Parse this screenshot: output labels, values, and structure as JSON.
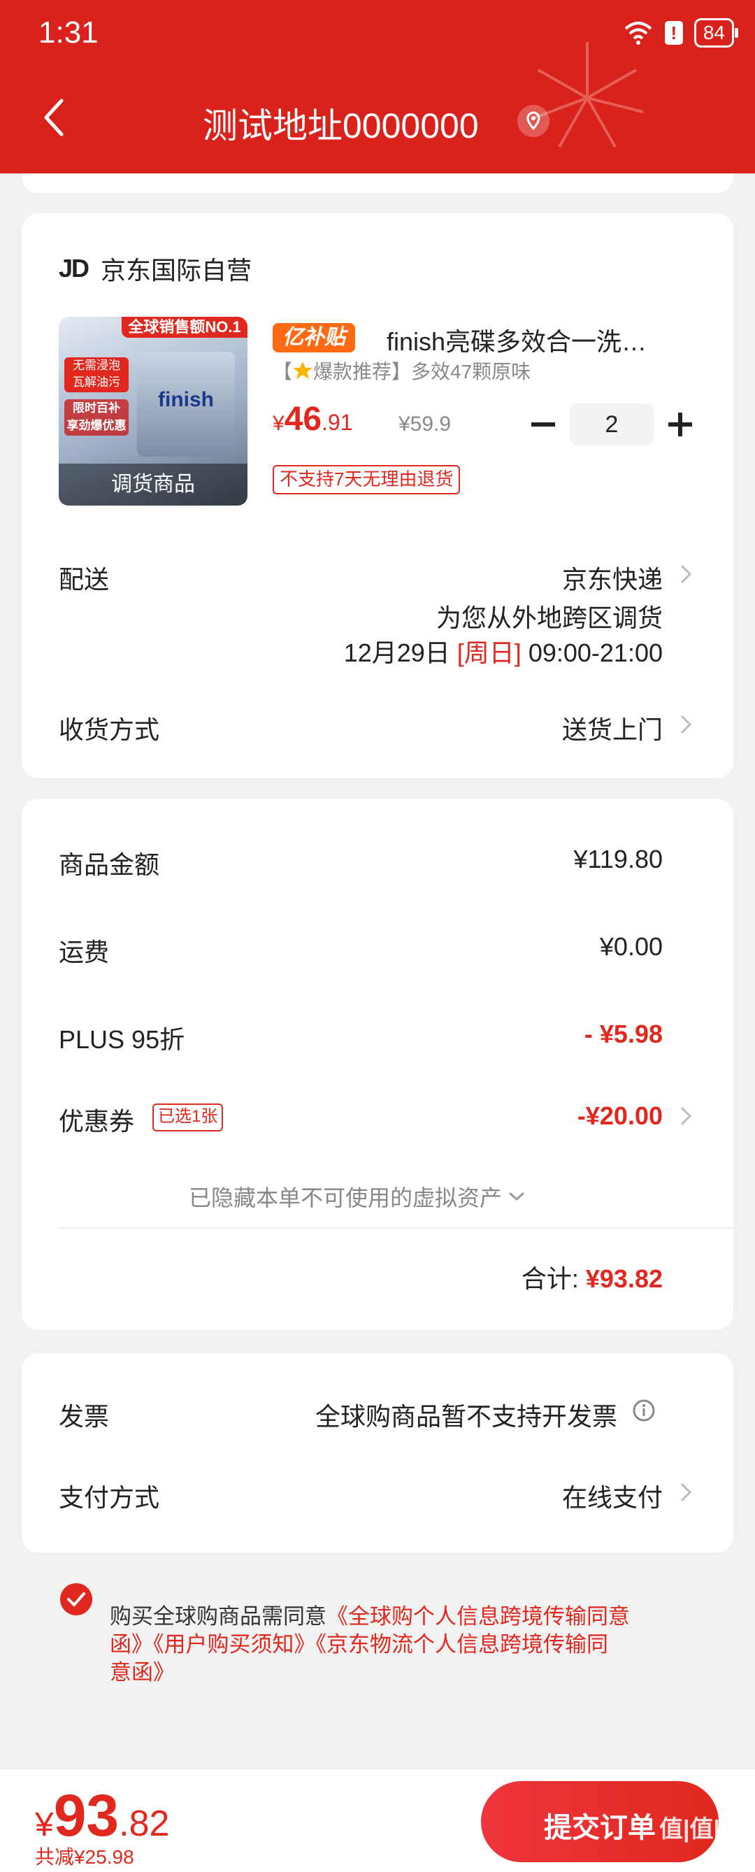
{
  "status": {
    "time": "1:31",
    "battery": "84"
  },
  "header": {
    "title": "测试地址0000000"
  },
  "shop": {
    "logo": "JD",
    "name": "京东国际自营"
  },
  "product": {
    "badge": "亿补贴",
    "name": "finish亮碟多效合一洗…",
    "subtitle_prefix": "【",
    "subtitle_tag": "爆款推荐】多效47颗原味",
    "price_symbol": "¥",
    "price_int": "46",
    "price_dec": ".91",
    "original_price": "¥59.9",
    "quantity": "2",
    "return_policy": "不支持7天无理由退货",
    "image_label": "调货商品",
    "image_banner": "全球销售额NO.1",
    "image_texts": [
      "无需浸泡",
      "瓦解油污",
      "限时百补",
      "享劲爆优惠"
    ],
    "image_brand": "finish"
  },
  "delivery": {
    "label": "配送",
    "carrier": "京东快递",
    "note": "为您从外地跨区调货",
    "date": "12月29日",
    "weekday": "[周日]",
    "time": "09:00-21:00"
  },
  "receive": {
    "label": "收货方式",
    "value": "送货上门"
  },
  "summary": {
    "goods_label": "商品金额",
    "goods_value": "¥119.80",
    "shipping_label": "运费",
    "shipping_value": "¥0.00",
    "plus_label": "PLUS 95折",
    "plus_value": "- ¥5.98",
    "coupon_label": "优惠券",
    "coupon_tag": "已选1张",
    "coupon_value": "-¥20.00",
    "hidden_note": "已隐藏本单不可使用的虚拟资产",
    "total_label": "合计:",
    "total_value": "¥93.82"
  },
  "invoice": {
    "label": "发票",
    "value": "全球购商品暂不支持开发票"
  },
  "payment": {
    "label": "支付方式",
    "value": "在线支付"
  },
  "agreement": {
    "line1_a": "购买全球购商品需同意",
    "line1_b": "《全球购个人信息跨境传输同意",
    "line2": "函》《用户购买须知》《京东物流个人信息跨境传输同",
    "line3": "意函》"
  },
  "bottom": {
    "symbol": "¥",
    "total_int": "93",
    "total_dec": ".82",
    "saved": "共减¥25.98",
    "submit": "提交订单",
    "watermark": "值|值|值"
  },
  "colors": {
    "brand_red": "#d9221c",
    "accent_red": "#e0281e",
    "badge_orange": "#ff6a13"
  }
}
